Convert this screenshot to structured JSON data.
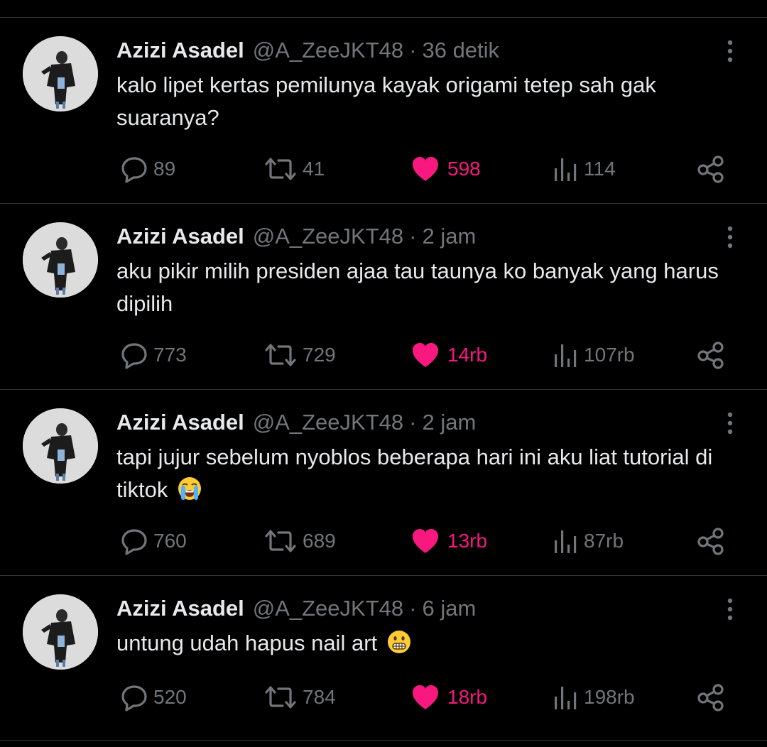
{
  "colors": {
    "background": "#000000",
    "text": "#e7e9ea",
    "muted": "#71767b",
    "like_active": "#f91880",
    "divider": "#2f3336"
  },
  "icons": {
    "reply": "speech-bubble-icon",
    "retweet": "retweet-arrows-icon",
    "like": "heart-icon",
    "views": "bar-chart-icon",
    "share": "share-nodes-icon",
    "more": "vertical-dots-icon"
  },
  "tweets": [
    {
      "name": "Azizi Asadel",
      "handle": "@A_ZeeJKT48",
      "separator": "·",
      "time": "36 detik",
      "text": "kalo lipet kertas pemilunya kayak origami tetep sah gak suaranya?",
      "emoji": "",
      "replies": "89",
      "retweets": "41",
      "likes": "598",
      "views": "114"
    },
    {
      "name": "Azizi Asadel",
      "handle": "@A_ZeeJKT48",
      "separator": "·",
      "time": "2 jam",
      "text": "aku pikir milih presiden ajaa tau taunya ko banyak yang harus dipilih",
      "emoji": "",
      "replies": "773",
      "retweets": "729",
      "likes": "14rb",
      "views": "107rb"
    },
    {
      "name": "Azizi Asadel",
      "handle": "@A_ZeeJKT48",
      "separator": "·",
      "time": "2 jam",
      "text": "tapi jujur sebelum nyoblos beberapa hari ini aku liat tutorial di tiktok",
      "emoji": "loudly-crying-face",
      "replies": "760",
      "retweets": "689",
      "likes": "13rb",
      "views": "87rb"
    },
    {
      "name": "Azizi Asadel",
      "handle": "@A_ZeeJKT48",
      "separator": "·",
      "time": "6 jam",
      "text": "untung udah hapus nail art",
      "emoji": "grimacing-face",
      "replies": "520",
      "retweets": "784",
      "likes": "18rb",
      "views": "198rb"
    }
  ]
}
